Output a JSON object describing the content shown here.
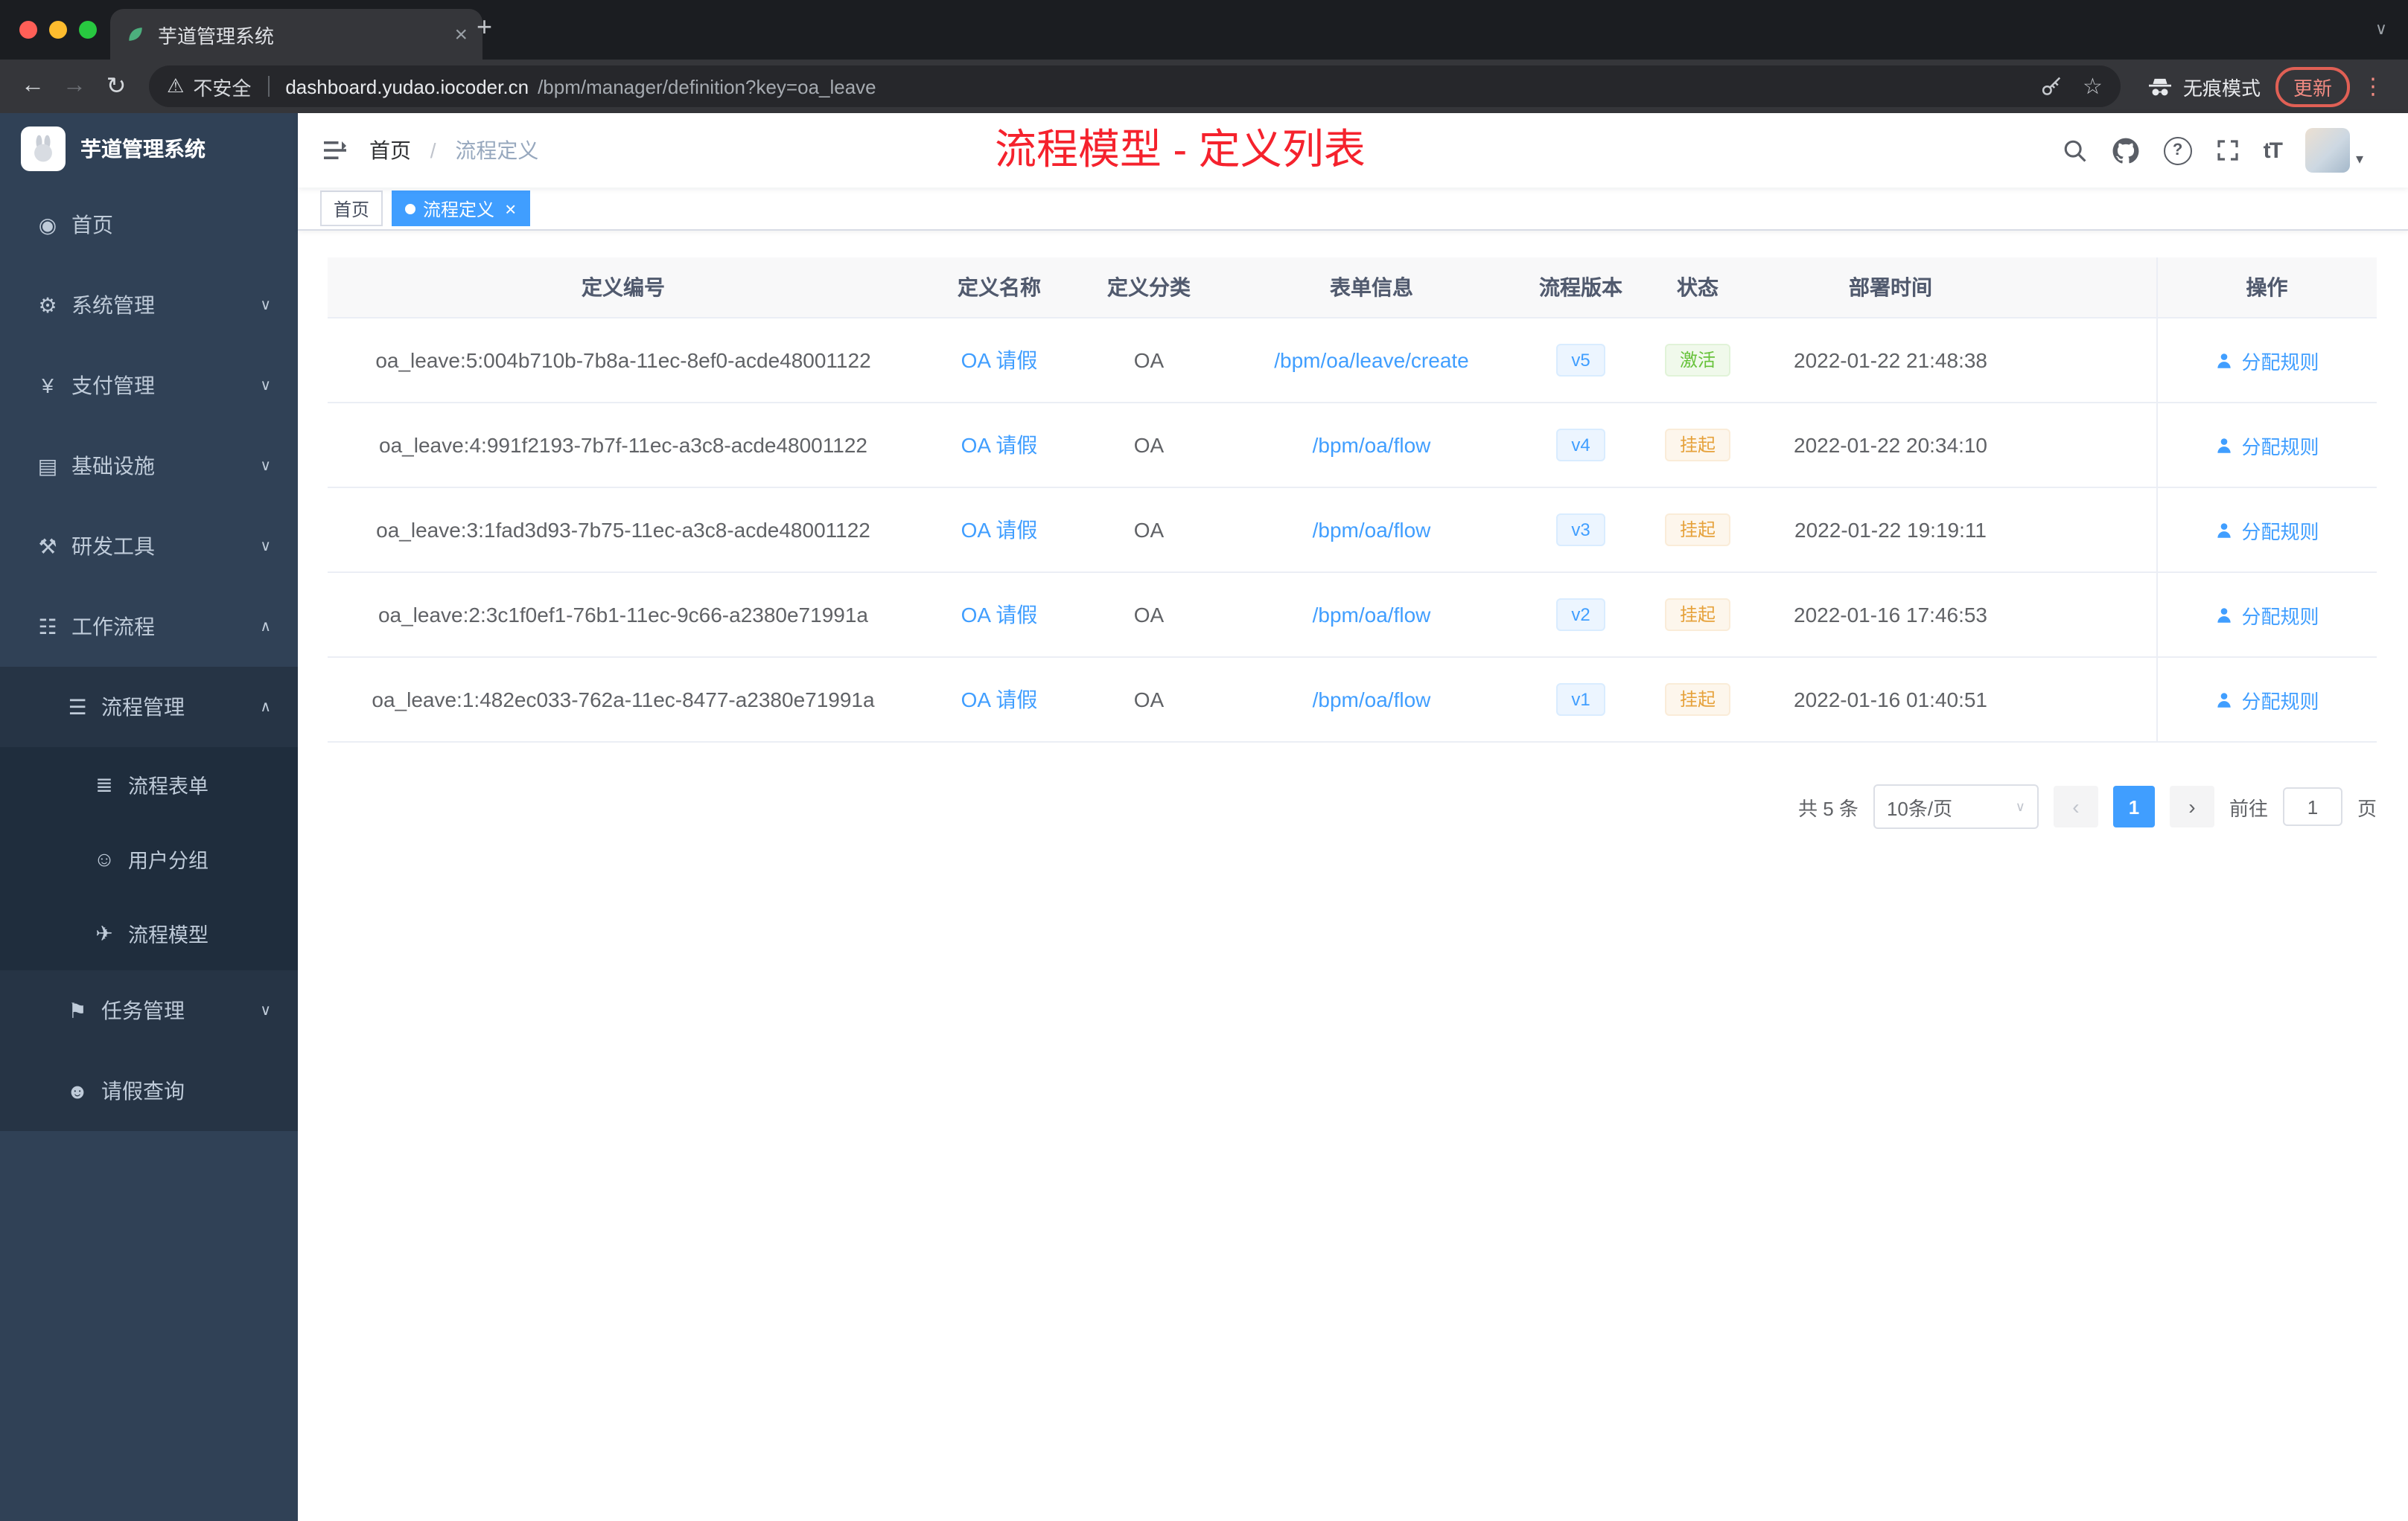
{
  "browser": {
    "tab_title": "芋道管理系统",
    "security_label": "不安全",
    "url_host": "dashboard.yudao.iocoder.cn",
    "url_path": "/bpm/manager/definition?key=oa_leave",
    "incognito_label": "无痕模式",
    "update_label": "更新"
  },
  "icons": {
    "dashboard": "◉",
    "settings": "⚙",
    "payment": "¥",
    "infra": "▤",
    "devtools": "⚒",
    "workflow": "☷",
    "process": "☰",
    "form": "≣",
    "users": "☺",
    "model": "✈",
    "task": "⚑",
    "person": "☻",
    "chevron_down": "∨",
    "chevron_up": "∧",
    "back": "←",
    "forward": "→",
    "reload": "↻",
    "star": "☆",
    "warning": "⚠",
    "close": "×",
    "plus": "+",
    "kebab": "⋮",
    "caret_down": "▾",
    "prev": "‹",
    "next": "›",
    "help": "?",
    "fontsize": "tT"
  },
  "sidebar": {
    "title": "芋道管理系统",
    "items": [
      {
        "label": "首页"
      },
      {
        "label": "系统管理"
      },
      {
        "label": "支付管理"
      },
      {
        "label": "基础设施"
      },
      {
        "label": "研发工具"
      },
      {
        "label": "工作流程"
      },
      {
        "label": "流程管理"
      },
      {
        "label": "流程表单"
      },
      {
        "label": "用户分组"
      },
      {
        "label": "流程模型"
      },
      {
        "label": "任务管理"
      },
      {
        "label": "请假查询"
      }
    ]
  },
  "header": {
    "breadcrumb_home": "首页",
    "breadcrumb_sep": "/",
    "breadcrumb_current": "流程定义",
    "annotation": "流程模型 - 定义列表"
  },
  "tags": {
    "home": "首页",
    "current": "流程定义"
  },
  "table": {
    "columns": [
      "定义编号",
      "定义名称",
      "定义分类",
      "表单信息",
      "流程版本",
      "状态",
      "部署时间",
      "操作"
    ],
    "rows": [
      {
        "id": "oa_leave:5:004b710b-7b8a-11ec-8ef0-acde48001122",
        "name": "OA 请假",
        "category": "OA",
        "form": "/bpm/oa/leave/create",
        "version": "v5",
        "status": "激活",
        "status_type": "success",
        "deploy_time": "2022-01-22 21:48:38",
        "action": "分配规则"
      },
      {
        "id": "oa_leave:4:991f2193-7b7f-11ec-a3c8-acde48001122",
        "name": "OA 请假",
        "category": "OA",
        "form": "/bpm/oa/flow",
        "version": "v4",
        "status": "挂起",
        "status_type": "warning",
        "deploy_time": "2022-01-22 20:34:10",
        "action": "分配规则"
      },
      {
        "id": "oa_leave:3:1fad3d93-7b75-11ec-a3c8-acde48001122",
        "name": "OA 请假",
        "category": "OA",
        "form": "/bpm/oa/flow",
        "version": "v3",
        "status": "挂起",
        "status_type": "warning",
        "deploy_time": "2022-01-22 19:19:11",
        "action": "分配规则"
      },
      {
        "id": "oa_leave:2:3c1f0ef1-76b1-11ec-9c66-a2380e71991a",
        "name": "OA 请假",
        "category": "OA",
        "form": "/bpm/oa/flow",
        "version": "v2",
        "status": "挂起",
        "status_type": "warning",
        "deploy_time": "2022-01-16 17:46:53",
        "action": "分配规则"
      },
      {
        "id": "oa_leave:1:482ec033-762a-11ec-8477-a2380e71991a",
        "name": "OA 请假",
        "category": "OA",
        "form": "/bpm/oa/flow",
        "version": "v1",
        "status": "挂起",
        "status_type": "warning",
        "deploy_time": "2022-01-16 01:40:51",
        "action": "分配规则"
      }
    ]
  },
  "pagination": {
    "total": "共 5 条",
    "page_size": "10条/页",
    "page": "1",
    "goto_label": "前往",
    "goto_value": "1",
    "unit": "页"
  },
  "colors": {
    "accent": "#409eff",
    "success": "#67c23a",
    "warning": "#e6a23c",
    "annotation_red": "#f5222d",
    "sidebar_bg": "#304156",
    "submenu_bg": "#1f2d3d"
  }
}
